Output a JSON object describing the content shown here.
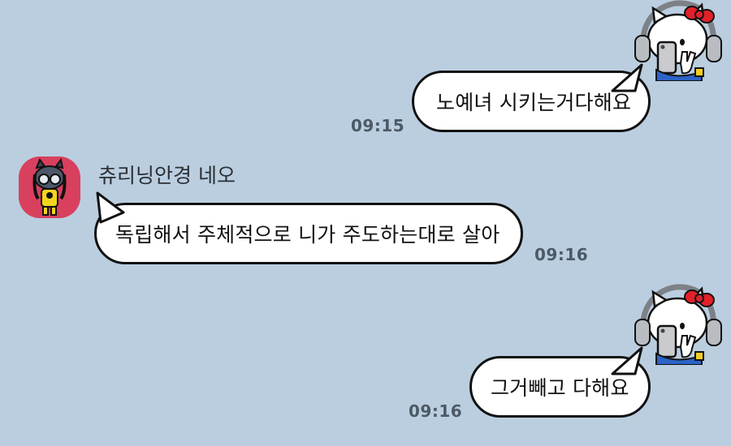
{
  "colors": {
    "background": "#bacee0",
    "bubble": "#ffffff",
    "bubble_border": "#111111",
    "time_text": "#4d5a66",
    "avatar_left_bg": "#d8405e"
  },
  "messages": [
    {
      "side": "outgoing",
      "text": "노예녀 시키는거다해요",
      "time": "09:15",
      "avatar_icon": "hello-kitty-headphones-icon"
    },
    {
      "side": "incoming",
      "sender": "츄리닝안경 네오",
      "text": "독립해서 주체적으로 니가 주도하는대로 살아",
      "time": "09:16",
      "avatar_icon": "neo-cat-glasses-icon"
    },
    {
      "side": "outgoing",
      "text": "그거빼고 다해요",
      "time": "09:16",
      "avatar_icon": "hello-kitty-headphones-icon"
    }
  ]
}
